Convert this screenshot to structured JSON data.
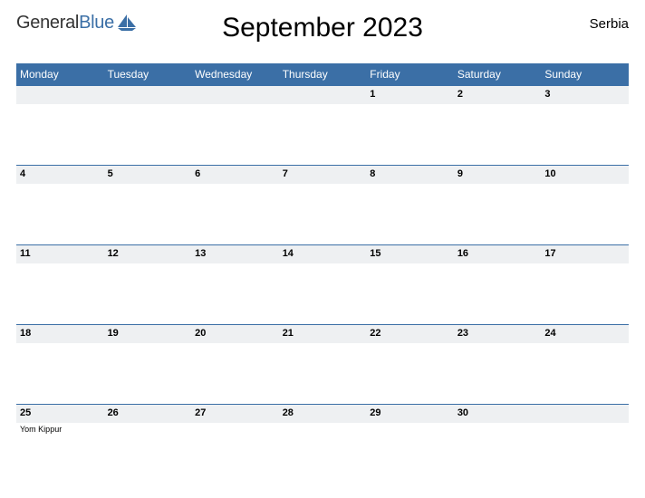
{
  "logo": {
    "general": "General",
    "blue": "Blue"
  },
  "title": "September 2023",
  "country": "Serbia",
  "day_headers": [
    "Monday",
    "Tuesday",
    "Wednesday",
    "Thursday",
    "Friday",
    "Saturday",
    "Sunday"
  ],
  "weeks": [
    [
      {
        "num": "",
        "event": ""
      },
      {
        "num": "",
        "event": ""
      },
      {
        "num": "",
        "event": ""
      },
      {
        "num": "",
        "event": ""
      },
      {
        "num": "1",
        "event": ""
      },
      {
        "num": "2",
        "event": ""
      },
      {
        "num": "3",
        "event": ""
      }
    ],
    [
      {
        "num": "4",
        "event": ""
      },
      {
        "num": "5",
        "event": ""
      },
      {
        "num": "6",
        "event": ""
      },
      {
        "num": "7",
        "event": ""
      },
      {
        "num": "8",
        "event": ""
      },
      {
        "num": "9",
        "event": ""
      },
      {
        "num": "10",
        "event": ""
      }
    ],
    [
      {
        "num": "11",
        "event": ""
      },
      {
        "num": "12",
        "event": ""
      },
      {
        "num": "13",
        "event": ""
      },
      {
        "num": "14",
        "event": ""
      },
      {
        "num": "15",
        "event": ""
      },
      {
        "num": "16",
        "event": ""
      },
      {
        "num": "17",
        "event": ""
      }
    ],
    [
      {
        "num": "18",
        "event": ""
      },
      {
        "num": "19",
        "event": ""
      },
      {
        "num": "20",
        "event": ""
      },
      {
        "num": "21",
        "event": ""
      },
      {
        "num": "22",
        "event": ""
      },
      {
        "num": "23",
        "event": ""
      },
      {
        "num": "24",
        "event": ""
      }
    ],
    [
      {
        "num": "25",
        "event": "Yom Kippur"
      },
      {
        "num": "26",
        "event": ""
      },
      {
        "num": "27",
        "event": ""
      },
      {
        "num": "28",
        "event": ""
      },
      {
        "num": "29",
        "event": ""
      },
      {
        "num": "30",
        "event": ""
      },
      {
        "num": "",
        "event": ""
      }
    ]
  ]
}
